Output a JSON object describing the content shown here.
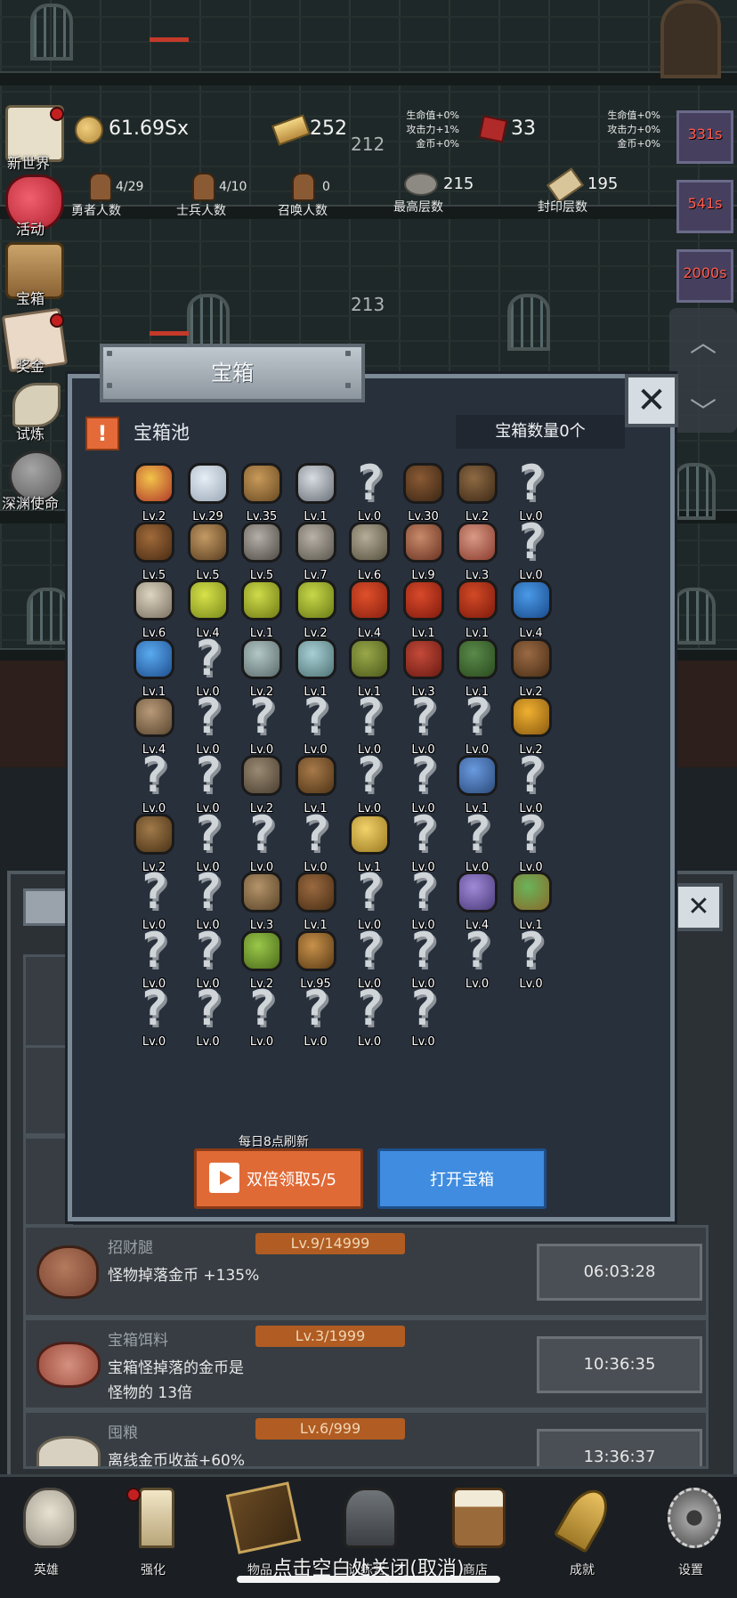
{
  "floors": [
    "212",
    "213"
  ],
  "stats": {
    "gold": "61.69Sx",
    "bars": "252",
    "gems": "33",
    "bonus_left": [
      "生命值+0%",
      "攻击力+1%",
      "金币+0%"
    ],
    "bonus_right": [
      "生命值+0%",
      "攻击力+0%",
      "金币+0%"
    ],
    "heroes": {
      "value": "4/29",
      "label": "勇者人数"
    },
    "soldiers": {
      "value": "4/10",
      "label": "士兵人数"
    },
    "summons": {
      "value": "0",
      "label": "召唤人数"
    },
    "max_floor": {
      "value": "215",
      "label": "最高层数"
    },
    "seal_floor": {
      "value": "195",
      "label": "封印层数"
    }
  },
  "left_menu": [
    "新世界",
    "活动",
    "宝箱",
    "奖金",
    "试炼",
    "深渊使命"
  ],
  "timers": [
    "331s",
    "541s",
    "2000s"
  ],
  "modal": {
    "title": "宝箱",
    "close": "✕",
    "pool_title": "宝箱池",
    "count": "宝箱数量0个",
    "refresh_note": "每日8点刷新",
    "double_btn": "双倍领取5/5",
    "open_btn": "打开宝箱",
    "items": [
      {
        "icon": "crown-icon",
        "lv": "Lv.2"
      },
      {
        "icon": "diamond-icon",
        "lv": "Lv.29"
      },
      {
        "icon": "wood-sword-icon",
        "lv": "Lv.35"
      },
      {
        "icon": "sword-icon",
        "lv": "Lv.1"
      },
      {
        "icon": "unknown-icon",
        "lv": "Lv.0"
      },
      {
        "icon": "armor-icon",
        "lv": "Lv.30"
      },
      {
        "icon": "backpack-icon",
        "lv": "Lv.2"
      },
      {
        "icon": "unknown-icon",
        "lv": "Lv.0"
      },
      {
        "icon": "leather-helmet-icon",
        "lv": "Lv.5"
      },
      {
        "icon": "dagger-icon",
        "lv": "Lv.5"
      },
      {
        "icon": "knight-helmet-icon",
        "lv": "Lv.5"
      },
      {
        "icon": "hammer-icon",
        "lv": "Lv.7"
      },
      {
        "icon": "great-helm-icon",
        "lv": "Lv.6"
      },
      {
        "icon": "ham-icon",
        "lv": "Lv.9"
      },
      {
        "icon": "steak-icon",
        "lv": "Lv.3"
      },
      {
        "icon": "unknown-icon",
        "lv": "Lv.0"
      },
      {
        "icon": "flour-sack-icon",
        "lv": "Lv.6"
      },
      {
        "icon": "yellow-potion-icon",
        "lv": "Lv.4"
      },
      {
        "icon": "yellow-flask-icon",
        "lv": "Lv.1"
      },
      {
        "icon": "yellow-round-potion-icon",
        "lv": "Lv.2"
      },
      {
        "icon": "red-potion-icon",
        "lv": "Lv.4"
      },
      {
        "icon": "red-flask-icon",
        "lv": "Lv.1"
      },
      {
        "icon": "red-round-potion-icon",
        "lv": "Lv.1"
      },
      {
        "icon": "blue-potion-icon",
        "lv": "Lv.4"
      },
      {
        "icon": "blue-flask-icon",
        "lv": "Lv.1"
      },
      {
        "icon": "unknown-icon",
        "lv": "Lv.0"
      },
      {
        "icon": "clear-bottle-icon",
        "lv": "Lv.2"
      },
      {
        "icon": "cyan-bottle-icon",
        "lv": "Lv.1"
      },
      {
        "icon": "green-bottle-icon",
        "lv": "Lv.1"
      },
      {
        "icon": "red-bottle-icon",
        "lv": "Lv.3"
      },
      {
        "icon": "winged-boot-icon",
        "lv": "Lv.1"
      },
      {
        "icon": "boot-icon",
        "lv": "Lv.2"
      },
      {
        "icon": "shoe-icon",
        "lv": "Lv.4"
      },
      {
        "icon": "unknown-icon",
        "lv": "Lv.0"
      },
      {
        "icon": "unknown-icon",
        "lv": "Lv.0"
      },
      {
        "icon": "unknown-icon",
        "lv": "Lv.0"
      },
      {
        "icon": "unknown-icon",
        "lv": "Lv.0"
      },
      {
        "icon": "unknown-icon",
        "lv": "Lv.0"
      },
      {
        "icon": "unknown-icon",
        "lv": "Lv.0"
      },
      {
        "icon": "torch-icon",
        "lv": "Lv.2"
      },
      {
        "icon": "unknown-icon",
        "lv": "Lv.0"
      },
      {
        "icon": "unknown-icon",
        "lv": "Lv.0"
      },
      {
        "icon": "pickaxe-icon",
        "lv": "Lv.2"
      },
      {
        "icon": "staff-icon",
        "lv": "Lv.1"
      },
      {
        "icon": "unknown-icon",
        "lv": "Lv.0"
      },
      {
        "icon": "unknown-icon",
        "lv": "Lv.0"
      },
      {
        "icon": "magic-wand-icon",
        "lv": "Lv.1"
      },
      {
        "icon": "unknown-icon",
        "lv": "Lv.0"
      },
      {
        "icon": "big-backpack-icon",
        "lv": "Lv.2"
      },
      {
        "icon": "unknown-icon",
        "lv": "Lv.0"
      },
      {
        "icon": "unknown-icon",
        "lv": "Lv.0"
      },
      {
        "icon": "unknown-icon",
        "lv": "Lv.0"
      },
      {
        "icon": "cheese-icon",
        "lv": "Lv.1"
      },
      {
        "icon": "unknown-icon",
        "lv": "Lv.0"
      },
      {
        "icon": "unknown-icon",
        "lv": "Lv.0"
      },
      {
        "icon": "unknown-icon",
        "lv": "Lv.0"
      },
      {
        "icon": "unknown-icon",
        "lv": "Lv.0"
      },
      {
        "icon": "unknown-icon",
        "lv": "Lv.0"
      },
      {
        "icon": "bow-icon",
        "lv": "Lv.3"
      },
      {
        "icon": "quiver-icon",
        "lv": "Lv.1"
      },
      {
        "icon": "unknown-icon",
        "lv": "Lv.0"
      },
      {
        "icon": "unknown-icon",
        "lv": "Lv.0"
      },
      {
        "icon": "dice-icon",
        "lv": "Lv.4"
      },
      {
        "icon": "amulet-icon",
        "lv": "Lv.1"
      },
      {
        "icon": "unknown-icon",
        "lv": "Lv.0"
      },
      {
        "icon": "unknown-icon",
        "lv": "Lv.0"
      },
      {
        "icon": "green-wand-icon",
        "lv": "Lv.2"
      },
      {
        "icon": "beer-mug-icon",
        "lv": "Lv.95"
      },
      {
        "icon": "unknown-icon",
        "lv": "Lv.0"
      },
      {
        "icon": "unknown-icon",
        "lv": "Lv.0"
      },
      {
        "icon": "unknown-icon",
        "lv": "Lv.0"
      },
      {
        "icon": "unknown-icon",
        "lv": "Lv.0"
      },
      {
        "icon": "unknown-icon",
        "lv": "Lv.0"
      },
      {
        "icon": "unknown-icon",
        "lv": "Lv.0"
      },
      {
        "icon": "unknown-icon",
        "lv": "Lv.0"
      },
      {
        "icon": "unknown-icon",
        "lv": "Lv.0"
      },
      {
        "icon": "unknown-icon",
        "lv": "Lv.0"
      },
      {
        "icon": "unknown-icon",
        "lv": "Lv.0"
      }
    ]
  },
  "upgrades": [
    {
      "name": "招财腿",
      "level": "Lv.9/14999",
      "desc": "怪物掉落金币 +135%",
      "timer": "06:03:28"
    },
    {
      "name": "宝箱饵料",
      "level": "Lv.3/1999",
      "desc": "宝箱怪掉落的金币是\n怪物的 13倍",
      "timer": "10:36:35"
    },
    {
      "name": "囤粮",
      "level": "Lv.6/999",
      "desc": "离线金币收益+60%",
      "timer": "13:36:37"
    }
  ],
  "nav": [
    "英雄",
    "强化",
    "物品",
    "训练营",
    "商店",
    "成就",
    "设置"
  ],
  "hint": "点击空白处关闭(取消)",
  "colors": {
    "accent_orange": "#e06a36",
    "accent_blue": "#3f8ce0",
    "level_badge": "#b05c22",
    "timer_red": "#ff5a4a"
  }
}
